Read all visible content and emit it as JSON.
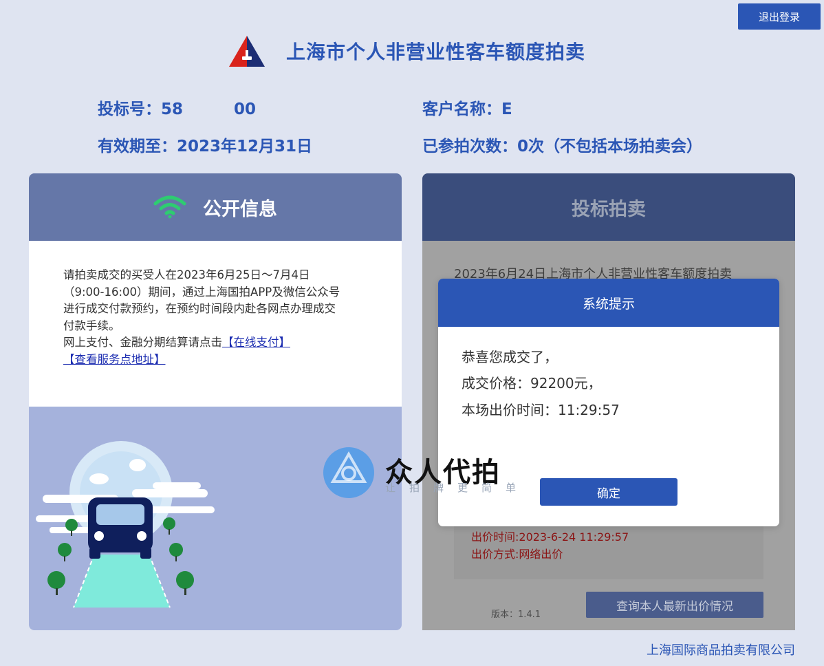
{
  "header": {
    "title": "上海市个人非营业性客车额度拍卖",
    "logout_label": "退出登录"
  },
  "user_info": {
    "bid_number": "投标号：58",
    "bid_number_tail": "00",
    "customer_name": "客户名称：",
    "customer_name_tail": "E",
    "valid_until": "有效期至：2023年12月31日",
    "auction_count": "已参拍次数：0次（不包括本场拍卖会）"
  },
  "public_info": {
    "title": "公开信息",
    "lines": [
      "请拍卖成交的买受人在2023年6月25日～7月4日",
      "（9:00-16:00）期间，通过上海国拍APP及微信公众号",
      "进行成交付款预约，在预约时间段内赴各网点办理成交",
      "付款手续。"
    ],
    "pay_prefix": "网上支付、金融分期结算请点击",
    "online_pay_link": "【在线支付】",
    "service_link": "【查看服务点地址】"
  },
  "bidding": {
    "title": "投标拍卖",
    "announcement": "2023年6月24日上海市个人非营业性客车额度拍卖",
    "bid_time": "出价时间:2023-6-24 11:29:57",
    "bid_method": "出价方式:网络出价",
    "version": "版本：1.4.1",
    "query_button": "查询本人最新出价情况"
  },
  "modal": {
    "title": "系统提示",
    "line1": "恭喜您成交了，",
    "line2": "成交价格：92200元，",
    "line3": "本场出价时间：11:29:57",
    "ok_label": "确定"
  },
  "watermark": {
    "name": "众人代拍",
    "slogan": "让拍牌更简单"
  },
  "footer": {
    "company": "上海国际商品拍卖有限公司"
  },
  "colors": {
    "brand_blue": "#2b56b5",
    "page_bg": "#dfe4f1",
    "bid_text_red": "#8b1414",
    "wifi_green": "#2ecc71"
  }
}
